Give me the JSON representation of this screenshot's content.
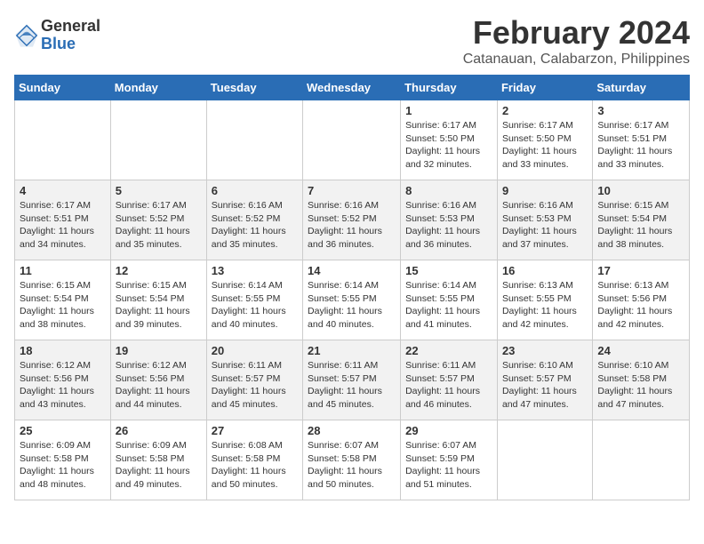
{
  "header": {
    "logo_general": "General",
    "logo_blue": "Blue",
    "title": "February 2024",
    "subtitle": "Catanauan, Calabarzon, Philippines"
  },
  "days": [
    "Sunday",
    "Monday",
    "Tuesday",
    "Wednesday",
    "Thursday",
    "Friday",
    "Saturday"
  ],
  "weeks": [
    [
      {
        "date": "",
        "info": ""
      },
      {
        "date": "",
        "info": ""
      },
      {
        "date": "",
        "info": ""
      },
      {
        "date": "",
        "info": ""
      },
      {
        "date": "1",
        "info": "Sunrise: 6:17 AM\nSunset: 5:50 PM\nDaylight: 11 hours and 32 minutes."
      },
      {
        "date": "2",
        "info": "Sunrise: 6:17 AM\nSunset: 5:50 PM\nDaylight: 11 hours and 33 minutes."
      },
      {
        "date": "3",
        "info": "Sunrise: 6:17 AM\nSunset: 5:51 PM\nDaylight: 11 hours and 33 minutes."
      }
    ],
    [
      {
        "date": "4",
        "info": "Sunrise: 6:17 AM\nSunset: 5:51 PM\nDaylight: 11 hours and 34 minutes."
      },
      {
        "date": "5",
        "info": "Sunrise: 6:17 AM\nSunset: 5:52 PM\nDaylight: 11 hours and 35 minutes."
      },
      {
        "date": "6",
        "info": "Sunrise: 6:16 AM\nSunset: 5:52 PM\nDaylight: 11 hours and 35 minutes."
      },
      {
        "date": "7",
        "info": "Sunrise: 6:16 AM\nSunset: 5:52 PM\nDaylight: 11 hours and 36 minutes."
      },
      {
        "date": "8",
        "info": "Sunrise: 6:16 AM\nSunset: 5:53 PM\nDaylight: 11 hours and 36 minutes."
      },
      {
        "date": "9",
        "info": "Sunrise: 6:16 AM\nSunset: 5:53 PM\nDaylight: 11 hours and 37 minutes."
      },
      {
        "date": "10",
        "info": "Sunrise: 6:15 AM\nSunset: 5:54 PM\nDaylight: 11 hours and 38 minutes."
      }
    ],
    [
      {
        "date": "11",
        "info": "Sunrise: 6:15 AM\nSunset: 5:54 PM\nDaylight: 11 hours and 38 minutes."
      },
      {
        "date": "12",
        "info": "Sunrise: 6:15 AM\nSunset: 5:54 PM\nDaylight: 11 hours and 39 minutes."
      },
      {
        "date": "13",
        "info": "Sunrise: 6:14 AM\nSunset: 5:55 PM\nDaylight: 11 hours and 40 minutes."
      },
      {
        "date": "14",
        "info": "Sunrise: 6:14 AM\nSunset: 5:55 PM\nDaylight: 11 hours and 40 minutes."
      },
      {
        "date": "15",
        "info": "Sunrise: 6:14 AM\nSunset: 5:55 PM\nDaylight: 11 hours and 41 minutes."
      },
      {
        "date": "16",
        "info": "Sunrise: 6:13 AM\nSunset: 5:55 PM\nDaylight: 11 hours and 42 minutes."
      },
      {
        "date": "17",
        "info": "Sunrise: 6:13 AM\nSunset: 5:56 PM\nDaylight: 11 hours and 42 minutes."
      }
    ],
    [
      {
        "date": "18",
        "info": "Sunrise: 6:12 AM\nSunset: 5:56 PM\nDaylight: 11 hours and 43 minutes."
      },
      {
        "date": "19",
        "info": "Sunrise: 6:12 AM\nSunset: 5:56 PM\nDaylight: 11 hours and 44 minutes."
      },
      {
        "date": "20",
        "info": "Sunrise: 6:11 AM\nSunset: 5:57 PM\nDaylight: 11 hours and 45 minutes."
      },
      {
        "date": "21",
        "info": "Sunrise: 6:11 AM\nSunset: 5:57 PM\nDaylight: 11 hours and 45 minutes."
      },
      {
        "date": "22",
        "info": "Sunrise: 6:11 AM\nSunset: 5:57 PM\nDaylight: 11 hours and 46 minutes."
      },
      {
        "date": "23",
        "info": "Sunrise: 6:10 AM\nSunset: 5:57 PM\nDaylight: 11 hours and 47 minutes."
      },
      {
        "date": "24",
        "info": "Sunrise: 6:10 AM\nSunset: 5:58 PM\nDaylight: 11 hours and 47 minutes."
      }
    ],
    [
      {
        "date": "25",
        "info": "Sunrise: 6:09 AM\nSunset: 5:58 PM\nDaylight: 11 hours and 48 minutes."
      },
      {
        "date": "26",
        "info": "Sunrise: 6:09 AM\nSunset: 5:58 PM\nDaylight: 11 hours and 49 minutes."
      },
      {
        "date": "27",
        "info": "Sunrise: 6:08 AM\nSunset: 5:58 PM\nDaylight: 11 hours and 50 minutes."
      },
      {
        "date": "28",
        "info": "Sunrise: 6:07 AM\nSunset: 5:58 PM\nDaylight: 11 hours and 50 minutes."
      },
      {
        "date": "29",
        "info": "Sunrise: 6:07 AM\nSunset: 5:59 PM\nDaylight: 11 hours and 51 minutes."
      },
      {
        "date": "",
        "info": ""
      },
      {
        "date": "",
        "info": ""
      }
    ]
  ]
}
